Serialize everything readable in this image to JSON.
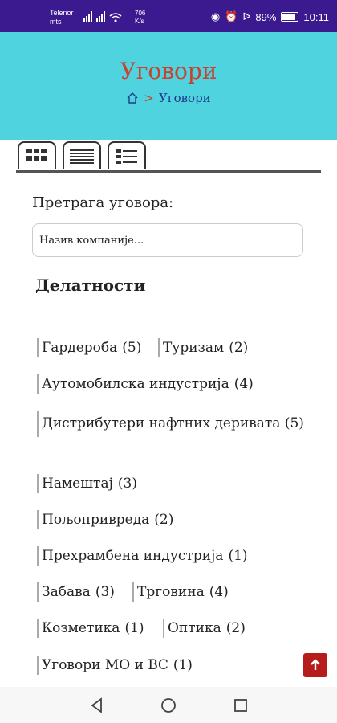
{
  "status_bar": {
    "carrier_line1": "Telenor",
    "carrier_line2": "mts",
    "speed_value": "706",
    "speed_unit": "K/s",
    "battery": "89%",
    "time": "10:11"
  },
  "header": {
    "title": "Уговори",
    "breadcrumb_separator": ">",
    "breadcrumb_current": "Уговори"
  },
  "view_tabs": [
    "grid-view",
    "list-view",
    "detail-list-view"
  ],
  "search": {
    "label": "Претрага уговора:",
    "placeholder": "Назив компаније..."
  },
  "categories_title": "Делатности",
  "categories": [
    {
      "label": "Гардероба",
      "count": "(5)"
    },
    {
      "label": "Туризам",
      "count": "(2)"
    },
    {
      "label": "Аутомобилска индустрија",
      "count": "(4)"
    },
    {
      "label": "Дистрибутери нафтних деривата",
      "count": "(5)"
    },
    {
      "label": "Намештај",
      "count": "(3)"
    },
    {
      "label": "Пољопривреда",
      "count": "(2)"
    },
    {
      "label": "Прехрамбена индустрија",
      "count": "(1)"
    },
    {
      "label": "Забава",
      "count": "(3)"
    },
    {
      "label": "Трговина",
      "count": "(4)"
    },
    {
      "label": "Козметика",
      "count": "(1)"
    },
    {
      "label": "Оптика",
      "count": "(2)"
    },
    {
      "label": "Уговори МО и ВС",
      "count": "(1)"
    }
  ],
  "colors": {
    "header_bg": "#4fd3de",
    "title": "#c84131",
    "status_bar": "#3a1a8e",
    "scroll_top_button": "#b71c1c"
  }
}
